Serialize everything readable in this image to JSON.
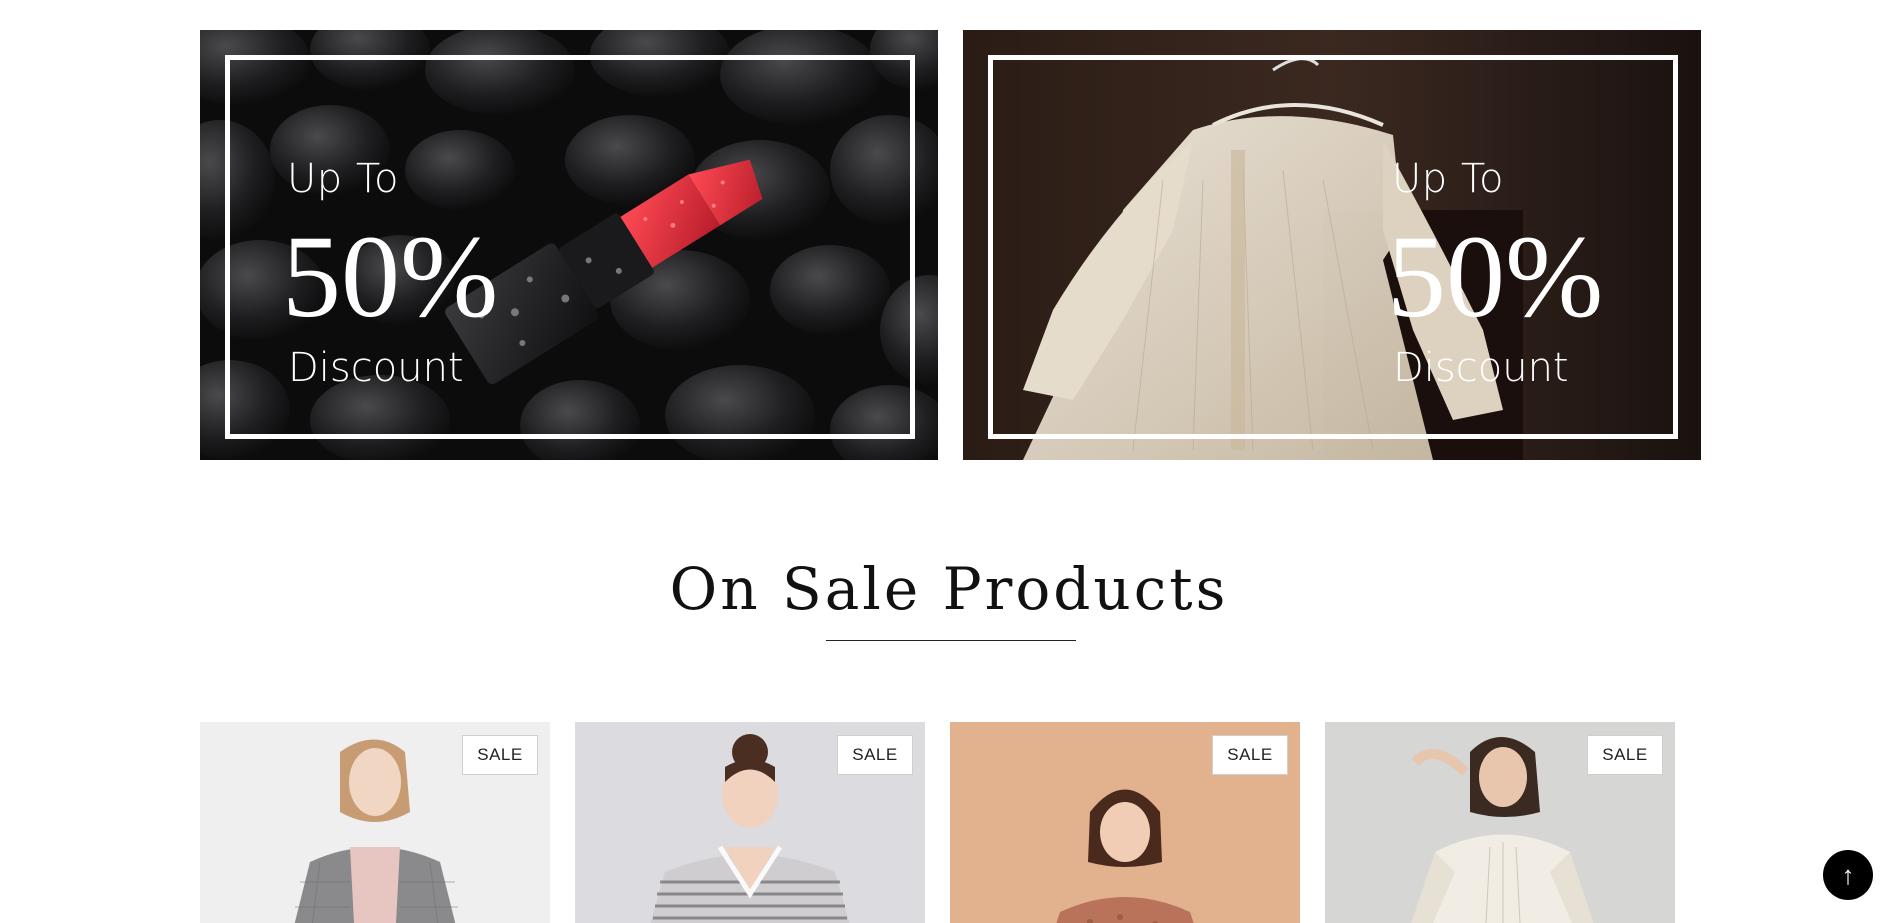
{
  "banners": [
    {
      "line1": "Up To",
      "line2": "50%",
      "line3": "Discount"
    },
    {
      "line1": "Up To",
      "line2": "50%",
      "line3": "Discount"
    }
  ],
  "section": {
    "title": "On Sale Products"
  },
  "products": [
    {
      "badge": "SALE"
    },
    {
      "badge": "SALE"
    },
    {
      "badge": "SALE"
    },
    {
      "badge": "SALE"
    }
  ],
  "back_to_top": {
    "icon": "arrow-up-icon",
    "glyph": "↑"
  },
  "colors": {
    "lipstick_red": "#e8323f",
    "background": "#ffffff",
    "text": "#111111"
  }
}
